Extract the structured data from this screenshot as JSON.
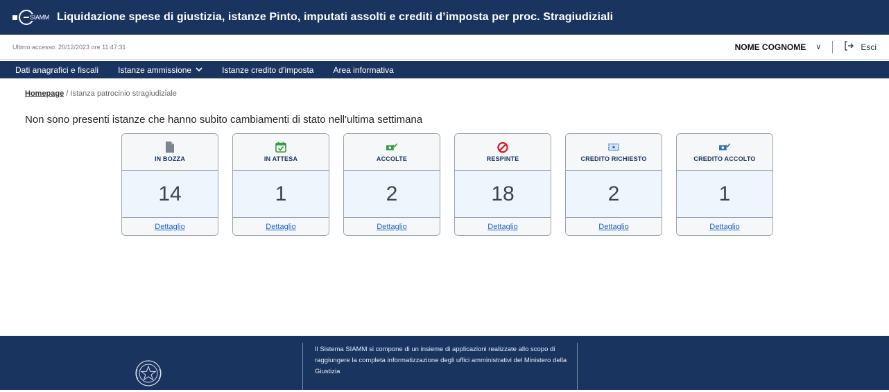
{
  "app": {
    "logo_text": "SIAMM",
    "title": "Liquidazione spese di giustizia, istanze Pinto, imputati assolti e crediti d’imposta per proc. Stragiudiziali"
  },
  "userbar": {
    "last_access": "Ultimo accesso: 20/12/2023 ore 11:47:31",
    "user_name": "NOME COGNOME",
    "exit_label": "Esci"
  },
  "nav": {
    "items": [
      {
        "label": "Dati anagrafici e fiscali"
      },
      {
        "label": "Istanze ammissione"
      },
      {
        "label": "Istanze credito d'imposta"
      },
      {
        "label": "Area informativa"
      }
    ]
  },
  "breadcrumb": {
    "home": "Homepage",
    "separator": " / ",
    "current": "Istanza patrocinio stragiudiziale"
  },
  "headline": "Non sono presenti istanze che hanno subito cambiamenti di stato nell'ultima settimana",
  "cards": [
    {
      "title": "IN BOZZA",
      "count": "14",
      "link": "Dettaglio",
      "icon": "document-icon"
    },
    {
      "title": "IN ATTESA",
      "count": "1",
      "link": "Dettaglio",
      "icon": "calendar-check-icon"
    },
    {
      "title": "ACCOLTE",
      "count": "2",
      "link": "Dettaglio",
      "icon": "money-check-icon"
    },
    {
      "title": "RESPINTE",
      "count": "18",
      "link": "Dettaglio",
      "icon": "prohibited-icon"
    },
    {
      "title": "CREDITO RICHIESTO",
      "count": "2",
      "link": "Dettaglio",
      "icon": "banknote-icon"
    },
    {
      "title": "CREDITO ACCOLTO",
      "count": "1",
      "link": "Dettaglio",
      "icon": "banknote-check-icon"
    }
  ],
  "footer": {
    "text": "Il Sistema SIAMM si compone di un insieme di applicazioni realizzate allo scopo di raggiungere la completa informatizzazione degli uffici amministrativi del Ministero della Giustizia"
  },
  "colors": {
    "brand_navy": "#1a3460",
    "link_blue": "#2165c4",
    "accepted_green": "#2e9d3a",
    "rejected_red": "#d0201f",
    "credit_blue": "#2f6fc0"
  }
}
